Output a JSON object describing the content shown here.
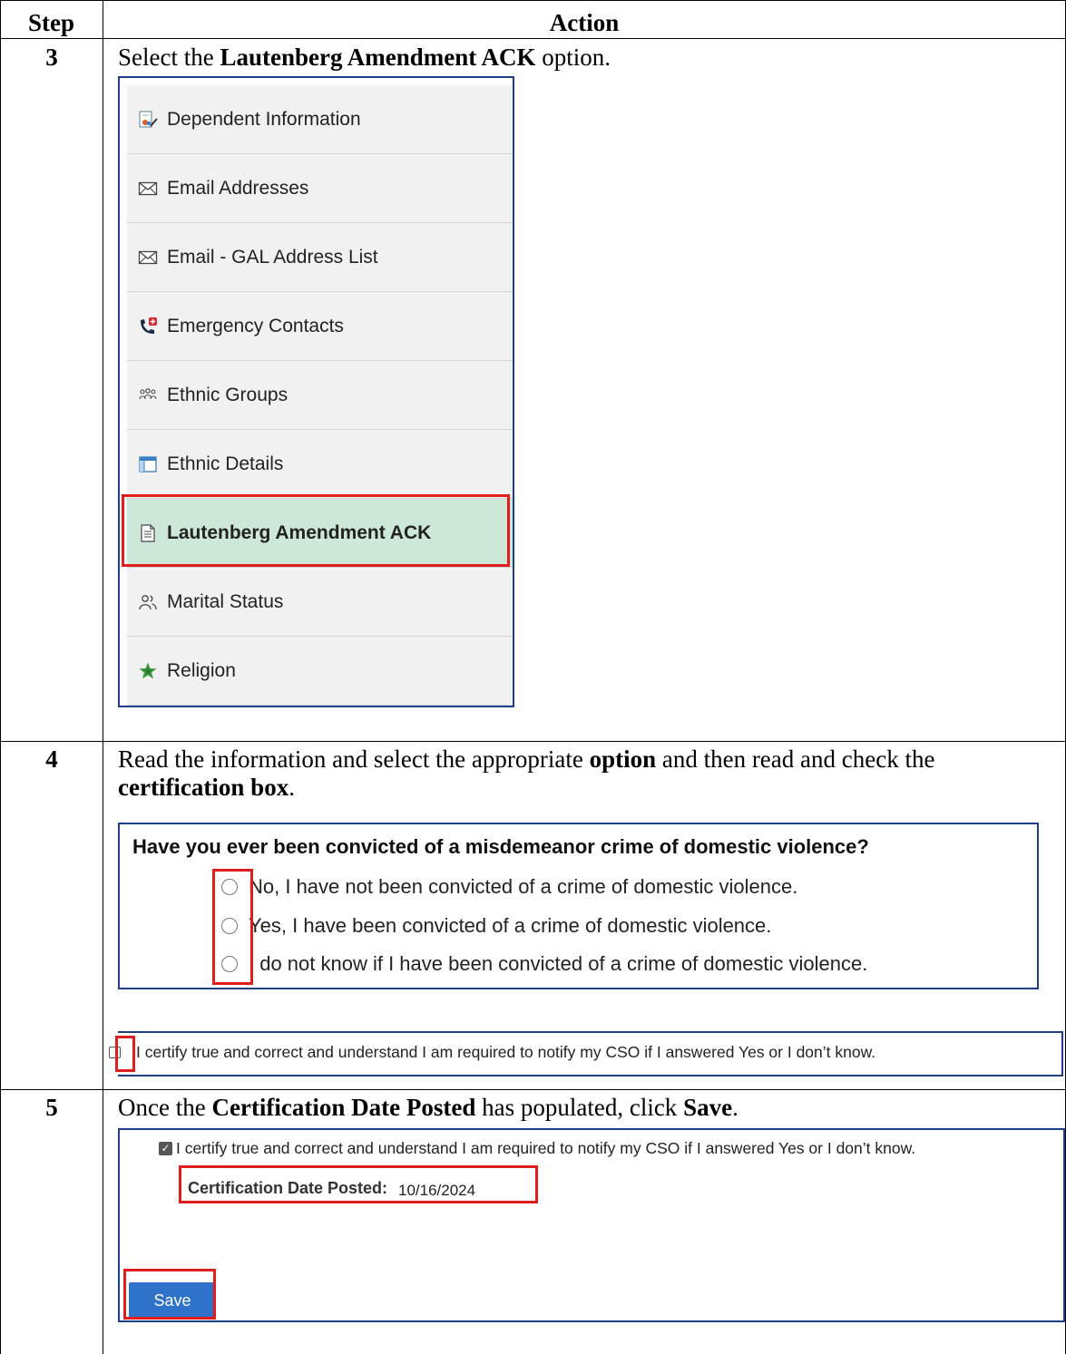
{
  "table": {
    "header_step": "Step",
    "header_action": "Action"
  },
  "step3": {
    "number": "3",
    "instruction_pre": "Select the ",
    "instruction_bold": "Lautenberg Amendment ACK",
    "instruction_post": " option.",
    "menu_items": [
      {
        "label": "Dependent Information",
        "icon": "dependent-info-icon"
      },
      {
        "label": "Email Addresses",
        "icon": "envelope-icon"
      },
      {
        "label": "Email - GAL Address List",
        "icon": "envelope-icon"
      },
      {
        "label": "Emergency Contacts",
        "icon": "phone-medical-icon"
      },
      {
        "label": "Ethnic Groups",
        "icon": "people-group-icon"
      },
      {
        "label": "Ethnic Details",
        "icon": "table-icon"
      },
      {
        "label": "Lautenberg Amendment ACK",
        "icon": "document-icon",
        "selected": true
      },
      {
        "label": "Marital Status",
        "icon": "two-people-icon"
      },
      {
        "label": "Religion",
        "icon": "star-icon"
      }
    ]
  },
  "step4": {
    "number": "4",
    "instruction_1": "Read the information and select the appropriate ",
    "instruction_bold_1": "option",
    "instruction_2": " and then read and check the ",
    "instruction_bold_2": "certification box",
    "instruction_3": ".",
    "question": "Have you ever been convicted of a misdemeanor crime of domestic violence?",
    "options": [
      "No, I have not been convicted of a crime of domestic violence.",
      "Yes, I have been convicted of a crime of domestic violence.",
      "I do not know if I have been convicted of a crime of domestic violence."
    ],
    "certification": "I certify true and correct and understand I am required to notify my CSO if I answered Yes or I don’t know."
  },
  "step5": {
    "number": "5",
    "instruction_1": "Once the ",
    "instruction_bold_1": "Certification Date Posted",
    "instruction_2": " has populated, click ",
    "instruction_bold_2": "Save",
    "instruction_3": ".",
    "certification": "I certify true and correct and understand I am required to notify my CSO if I answered Yes or I don’t know.",
    "date_label": "Certification Date Posted:",
    "date_value": "10/16/2024",
    "save_label": "Save"
  },
  "colors": {
    "highlight": "#e01d1d",
    "panel_border": "#1f3f8a",
    "selected_bg": "#cde8d9",
    "save_button": "#2f72c9"
  }
}
